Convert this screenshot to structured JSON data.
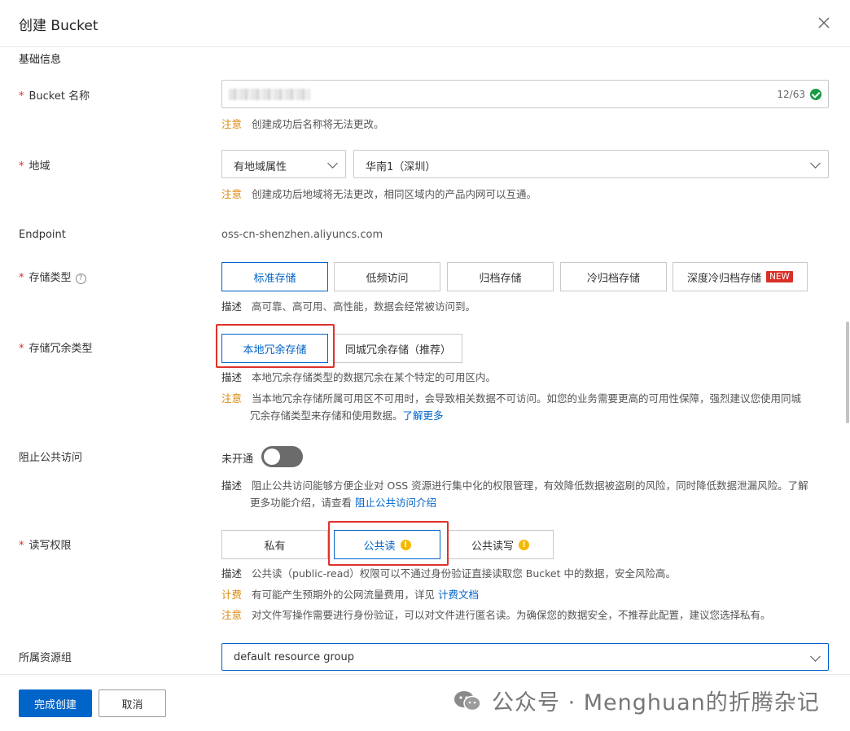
{
  "dialog": {
    "title": "创建 Bucket"
  },
  "section": {
    "basic_info": "基础信息"
  },
  "bucket_name": {
    "label": "Bucket 名称",
    "count": "12/63",
    "note_key": "注意",
    "note_text": "创建成功后名称将无法更改。"
  },
  "region": {
    "label": "地域",
    "type_value": "有地域属性",
    "region_value": "华南1（深圳）",
    "note_key": "注意",
    "note_text": "创建成功后地域将无法更改，相同区域内的产品内网可以互通。"
  },
  "endpoint": {
    "label": "Endpoint",
    "value": "oss-cn-shenzhen.aliyuncs.com"
  },
  "storage_class": {
    "label": "存储类型",
    "options": [
      "标准存储",
      "低频访问",
      "归档存储",
      "冷归档存储",
      "深度冷归档存储"
    ],
    "selected": "标准存储",
    "new_badge": "NEW",
    "desc_key": "描述",
    "desc_text": "高可靠、高可用、高性能，数据会经常被访问到。"
  },
  "redundancy": {
    "label": "存储冗余类型",
    "options": [
      "本地冗余存储",
      "同城冗余存储（推荐）"
    ],
    "selected": "本地冗余存储",
    "desc_key": "描述",
    "desc_text": "本地冗余存储类型的数据冗余在某个特定的可用区内。",
    "note_key": "注意",
    "note_line1": "当本地冗余存储所属可用区不可用时，会导致相关数据不可访问。如您的业务需要更高的可用性保障，强烈建议您使用同城",
    "note_line2": "冗余存储类型来存储和使用数据。",
    "note_link": "了解更多"
  },
  "block_public": {
    "label": "阻止公共访问",
    "state_text": "未开通",
    "enabled": false,
    "desc_key": "描述",
    "desc_line1": "阻止公共访问能够方便企业对 OSS 资源进行集中化的权限管理，有效降低数据被盗刷的风险，同时降低数据泄漏风险。了解",
    "desc_line2": "更多功能介绍，请查看",
    "desc_link": "阻止公共访问介绍"
  },
  "acl": {
    "label": "读写权限",
    "options": [
      "私有",
      "公共读",
      "公共读写"
    ],
    "selected": "公共读",
    "warn_glyph": "!",
    "desc_key": "描述",
    "desc_text": "公共读（public-read）权限可以不通过身份验证直接读取您 Bucket 中的数据，安全风险高。",
    "billing_key": "计费",
    "billing_text": "有可能产生预期外的公网流量费用，详见",
    "billing_link": "计费文档",
    "note_key": "注意",
    "note_text": "对文件写操作需要进行身份验证，可以对文件进行匿名读。为确保您的数据安全，不推荐此配置，建议您选择私有。"
  },
  "resource_group": {
    "label": "所属资源组",
    "value": "default resource group"
  },
  "footer": {
    "confirm": "完成创建",
    "cancel": "取消"
  },
  "watermark": {
    "text": "公众号 · Menghuan的折腾杂记"
  },
  "colors": {
    "primary": "#0064c8",
    "warning": "#d98a12",
    "required": "#d93026",
    "highlight_box": "#e0322b"
  }
}
